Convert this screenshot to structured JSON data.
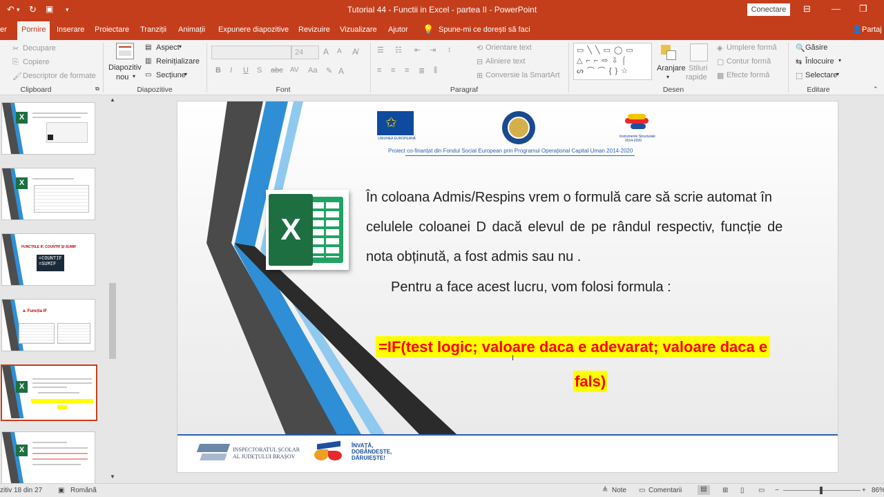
{
  "window": {
    "title": "Tutorial 44 - Functii in Excel - partea II  -  PowerPoint",
    "signin_label": "Conectare",
    "share_label": "Partaj"
  },
  "tabs": [
    "Pornire",
    "Inserare",
    "Proiectare",
    "Tranziții",
    "Animații",
    "Expunere diapozitive",
    "Revizuire",
    "Vizualizare",
    "Ajutor"
  ],
  "tab_left_partial": "er",
  "tell_me": "Spune-mi ce dorești să faci",
  "ribbon": {
    "clipboard": {
      "cut": "Decupare",
      "copy": "Copiere",
      "painter": "Descriptor de formate",
      "label": "Clipboard"
    },
    "slides": {
      "new_slide": "Diapozitiv",
      "new_slide2": "nou",
      "layout": "Aspect",
      "reset": "Reinițializare",
      "section": "Secțiune",
      "label": "Diapozitive"
    },
    "font": {
      "size": "24",
      "bold": "B",
      "italic": "I",
      "underline": "U",
      "strike": "S",
      "label": "Font"
    },
    "paragraph": {
      "direction": "Orientare text",
      "align": "Aliniere text",
      "smartart": "Conversie la SmartArt",
      "label": "Paragraf"
    },
    "drawing": {
      "arrange": "Aranjare",
      "styles": "Stiluri",
      "styles2": "rapide",
      "fill": "Umplere formă",
      "outline": "Contur formă",
      "effects": "Efecte formă",
      "label": "Desen"
    },
    "editing": {
      "find": "Găsire",
      "replace": "Înlocuire",
      "select": "Selectare",
      "label": "Editare"
    }
  },
  "thumbnails": [
    {
      "num": "",
      "selected": false
    },
    {
      "num": "",
      "selected": false
    },
    {
      "num": "",
      "selected": false,
      "line1": "FUNCȚIILE IF, COUNTIF ȘI SUMIF",
      "line2": "=COUNTIF",
      "line3": "=SUMIF"
    },
    {
      "num": "",
      "selected": false,
      "line1": "a. Funcția  IF"
    },
    {
      "num": "",
      "selected": true
    },
    {
      "num": "",
      "selected": false
    }
  ],
  "slide": {
    "eu_label": "UNIUNEA EUROPEANĂ",
    "struct_label": "Instrumente Structurale",
    "struct_years": "2014-2020",
    "project_line": "Proiect co-finanțat din Fondul Social European prin Programul Operațional Capital Uman 2014-2020",
    "para1_l1": "În coloana Admis/Respins vrem o formulă care să scrie automat în",
    "para1_l2": "celulele coloanei D dacă elevul de pe rândul respectiv, funcție de",
    "para1_l3": "nota obținută, a fost admis sau nu .",
    "para2": "Pentru a face acest lucru, vom folosi formula :",
    "formula_l1": "=IF(test logic; valoare daca e adevarat; valoare daca e",
    "formula_l2": "fals)",
    "isj_l1": "INSPECTORATUL ȘCOLAR",
    "isj_l2": "AL JUDEȚULUI BRAȘOV",
    "motto_l1": "ÎNVAȚĂ,",
    "motto_l2": "DOBÂNDEȘTE,",
    "motto_l3": "DĂRUIEȘTE!"
  },
  "status": {
    "slide_info": "zitiv 18 din 27",
    "language": "Română",
    "notes": "Note",
    "comments": "Comentarii",
    "zoom": "86%"
  },
  "colors": {
    "brand": "#c43e1c",
    "excel_green": "#1d6f42",
    "accent_blue": "#2e8fd6",
    "highlight": "#ffff00",
    "formula_red": "#ff0000"
  }
}
